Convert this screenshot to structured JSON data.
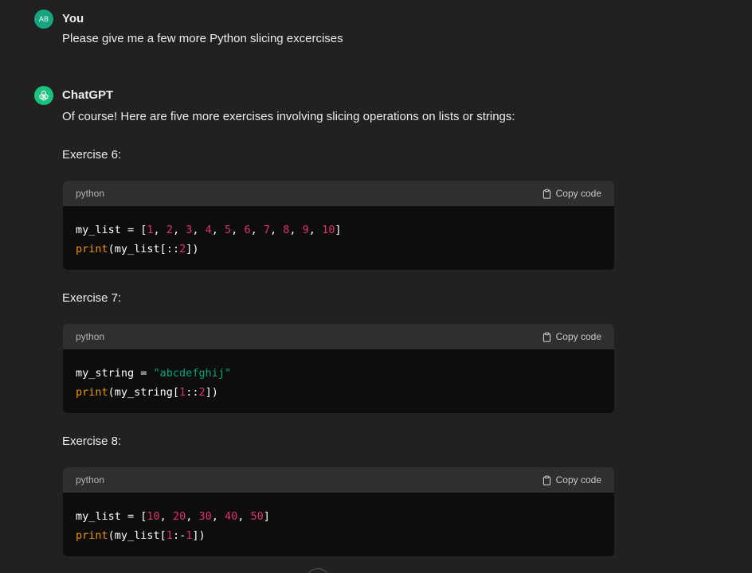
{
  "user": {
    "avatar_initials": "AB",
    "name": "You",
    "message": "Please give me a few more Python slicing excercises"
  },
  "assistant": {
    "name": "ChatGPT",
    "intro": "Of course! Here are five more exercises involving slicing operations on lists or strings:",
    "exercises": [
      {
        "title": "Exercise 6:",
        "lang": "python",
        "copy_label": "Copy code",
        "line1": [
          {
            "t": "my_list = [",
            "c": "plain"
          },
          {
            "t": "1",
            "c": "num"
          },
          {
            "t": ", ",
            "c": "plain"
          },
          {
            "t": "2",
            "c": "num"
          },
          {
            "t": ", ",
            "c": "plain"
          },
          {
            "t": "3",
            "c": "num"
          },
          {
            "t": ", ",
            "c": "plain"
          },
          {
            "t": "4",
            "c": "num"
          },
          {
            "t": ", ",
            "c": "plain"
          },
          {
            "t": "5",
            "c": "num"
          },
          {
            "t": ", ",
            "c": "plain"
          },
          {
            "t": "6",
            "c": "num"
          },
          {
            "t": ", ",
            "c": "plain"
          },
          {
            "t": "7",
            "c": "num"
          },
          {
            "t": ", ",
            "c": "plain"
          },
          {
            "t": "8",
            "c": "num"
          },
          {
            "t": ", ",
            "c": "plain"
          },
          {
            "t": "9",
            "c": "num"
          },
          {
            "t": ", ",
            "c": "plain"
          },
          {
            "t": "10",
            "c": "num"
          },
          {
            "t": "]",
            "c": "plain"
          }
        ],
        "line2": [
          {
            "t": "print",
            "c": "fn"
          },
          {
            "t": "(my_list[::",
            "c": "plain"
          },
          {
            "t": "2",
            "c": "num"
          },
          {
            "t": "])",
            "c": "plain"
          }
        ]
      },
      {
        "title": "Exercise 7:",
        "lang": "python",
        "copy_label": "Copy code",
        "line1": [
          {
            "t": "my_string = ",
            "c": "plain"
          },
          {
            "t": "\"abcdefghij\"",
            "c": "str"
          }
        ],
        "line2": [
          {
            "t": "print",
            "c": "fn"
          },
          {
            "t": "(my_string[",
            "c": "plain"
          },
          {
            "t": "1",
            "c": "num"
          },
          {
            "t": "::",
            "c": "plain"
          },
          {
            "t": "2",
            "c": "num"
          },
          {
            "t": "])",
            "c": "plain"
          }
        ]
      },
      {
        "title": "Exercise 8:",
        "lang": "python",
        "copy_label": "Copy code",
        "line1": [
          {
            "t": "my_list = [",
            "c": "plain"
          },
          {
            "t": "10",
            "c": "num"
          },
          {
            "t": ", ",
            "c": "plain"
          },
          {
            "t": "20",
            "c": "num"
          },
          {
            "t": ", ",
            "c": "plain"
          },
          {
            "t": "30",
            "c": "num"
          },
          {
            "t": ", ",
            "c": "plain"
          },
          {
            "t": "40",
            "c": "num"
          },
          {
            "t": ", ",
            "c": "plain"
          },
          {
            "t": "50",
            "c": "num"
          },
          {
            "t": "]",
            "c": "plain"
          }
        ],
        "line2": [
          {
            "t": "print",
            "c": "fn"
          },
          {
            "t": "(my_list[",
            "c": "plain"
          },
          {
            "t": "1",
            "c": "num"
          },
          {
            "t": ":-",
            "c": "plain"
          },
          {
            "t": "1",
            "c": "num"
          },
          {
            "t": "])",
            "c": "plain"
          }
        ]
      }
    ]
  },
  "colors": {
    "background": "#212121",
    "code_bg": "#0d0d0d",
    "code_header_bg": "#2f2f2f",
    "number": "#df3079",
    "function": "#e9950c",
    "string": "#00a67d",
    "avatar_green": "#19c37d"
  },
  "icons": {
    "assistant_avatar": "openai-logo-icon",
    "copy": "clipboard-icon",
    "scroll": "scroll-down-icon"
  }
}
